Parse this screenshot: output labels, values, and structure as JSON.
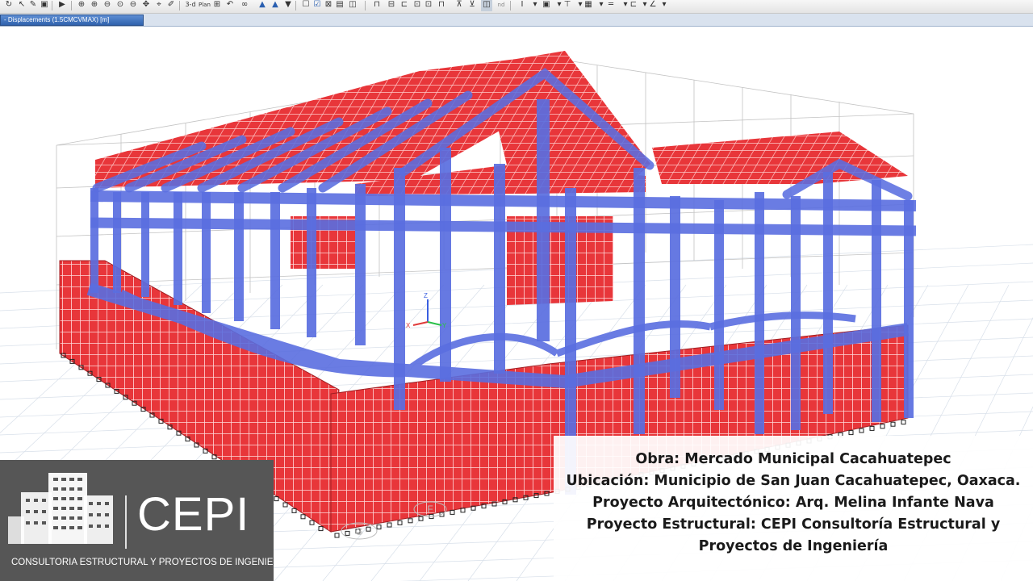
{
  "toolbar": {
    "view_mode_label": "3-d",
    "view_mode_sub": "Plan",
    "extra_label": "nd"
  },
  "view_tab": {
    "title": "- Displacements (1.5CMCVMAX)  [m]"
  },
  "model_view": {
    "axes_labels": [
      "X",
      "Y",
      "Z"
    ],
    "grid_bubble_labels": [
      "G",
      "F"
    ],
    "colors": {
      "frame_blue": "#5a6ee0",
      "shell_red": "#e8363a",
      "grid_line": "#c7c7c7",
      "support": "#222222"
    }
  },
  "logo": {
    "title": "CEPI",
    "subtitle": "CONSULTORIA ESTRUCTURAL Y PROYECTOS DE INGENIERIA",
    "background": "#565656"
  },
  "project_info": {
    "line1": "Obra: Mercado Municipal Cacahuatepec",
    "line2": "Ubicación: Municipio de San Juan Cacahuatepec, Oaxaca.",
    "line3": "Proyecto Arquitectónico: Arq. Melina Infante Nava",
    "line4": "Proyecto Estructural: CEPI Consultoría Estructural y",
    "line5": "Proyectos de Ingeniería"
  }
}
